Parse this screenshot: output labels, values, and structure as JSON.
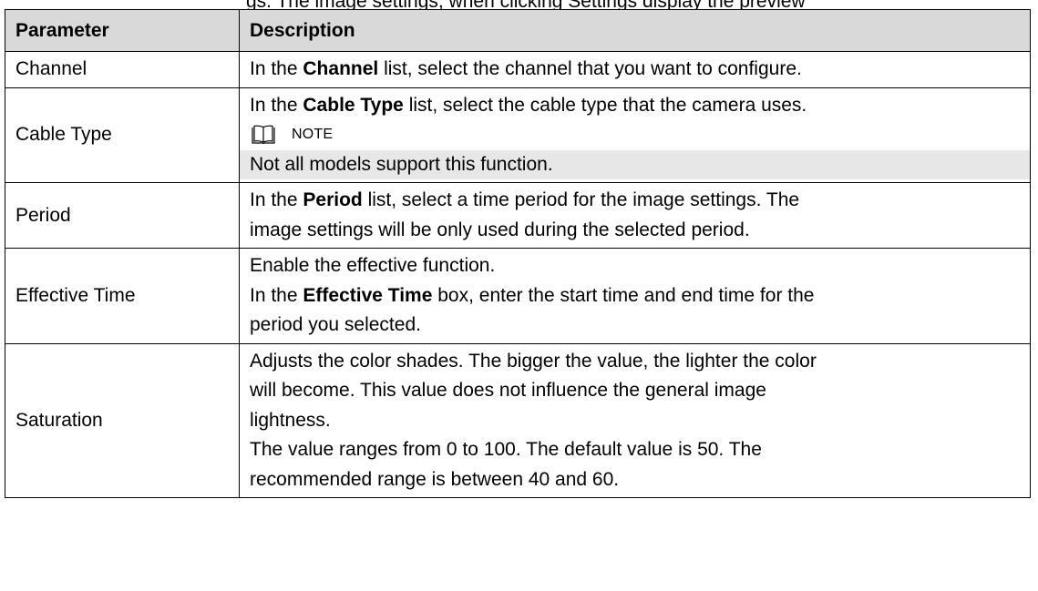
{
  "intro_fragment": "gs. The image settings, when clicking Settings display the preview",
  "table": {
    "header": {
      "parameter": "Parameter",
      "description": "Description"
    },
    "rows": {
      "channel": {
        "name": "Channel",
        "l1_pre": "In the ",
        "l1_bold": "Channel",
        "l1_post": " list, select the channel that you want to configure."
      },
      "cable_type": {
        "name": "Cable Type",
        "l1_pre": "In the ",
        "l1_bold": "Cable Type",
        "l1_post": " list, select the cable type that the camera uses.",
        "note_label": "NOTE",
        "note_text": "Not all models support this function."
      },
      "period": {
        "name": "Period",
        "l1_pre": "In the ",
        "l1_bold": "Period",
        "l1_post": " list, select a time period for the image settings. The",
        "l2": "image settings will be only used during the selected period."
      },
      "effective_time": {
        "name": "Effective Time",
        "l1": "Enable the effective function.",
        "l2_pre": "In the ",
        "l2_bold": "Effective Time",
        "l2_post": " box, enter the start time and end time for the",
        "l3": "period you selected."
      },
      "saturation": {
        "name": "Saturation",
        "l1": "Adjusts the color shades. The bigger the value, the lighter the color",
        "l2": "will become. This value does not influence the general image",
        "l3": "lightness.",
        "l4": "The value ranges from 0 to 100. The default value is 50. The",
        "l5": "recommended range is between 40 and 60."
      }
    }
  },
  "colors": {
    "header_bg": "#d9d9d9",
    "note_shade": "#e7e7e7",
    "border": "#000000"
  },
  "icons": {
    "note": "open-book-icon"
  }
}
